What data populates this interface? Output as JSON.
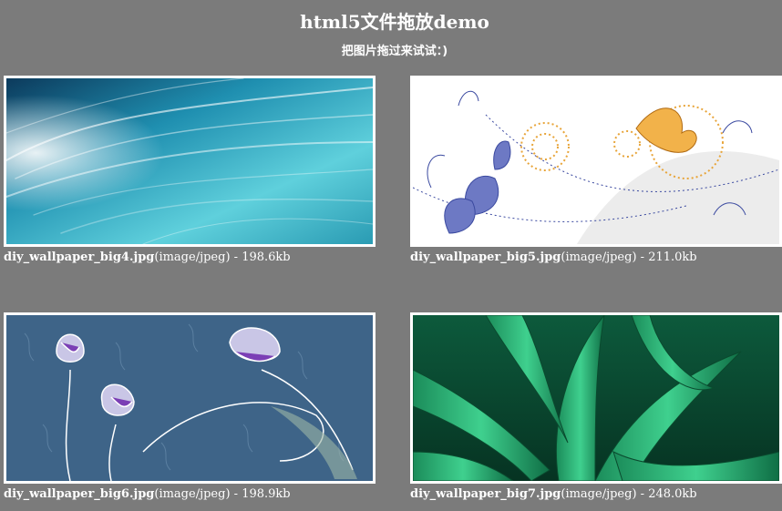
{
  "header": {
    "title": "html5文件拖放demo",
    "subtitle": "把图片拖过来试试：)"
  },
  "files": [
    {
      "name": "diy_wallpaper_big4.jpg",
      "type": "(image/jpeg)",
      "size": " - 198.6kb",
      "image": "teal-light-streaks"
    },
    {
      "name": "diy_wallpaper_big5.jpg",
      "type": "(image/jpeg)",
      "size": " - 211.0kb",
      "image": "lotus-butterfly-illustration"
    },
    {
      "name": "diy_wallpaper_big6.jpg",
      "type": "(image/jpeg)",
      "size": " - 198.9kb",
      "image": "tulips-on-blue-pattern"
    },
    {
      "name": "diy_wallpaper_big7.jpg",
      "type": "(image/jpeg)",
      "size": " - 248.0kb",
      "image": "green-leaves"
    }
  ],
  "colors": {
    "background": "#7b7b7b",
    "text": "#ffffff",
    "thumbnail_border": "#ffffff"
  }
}
